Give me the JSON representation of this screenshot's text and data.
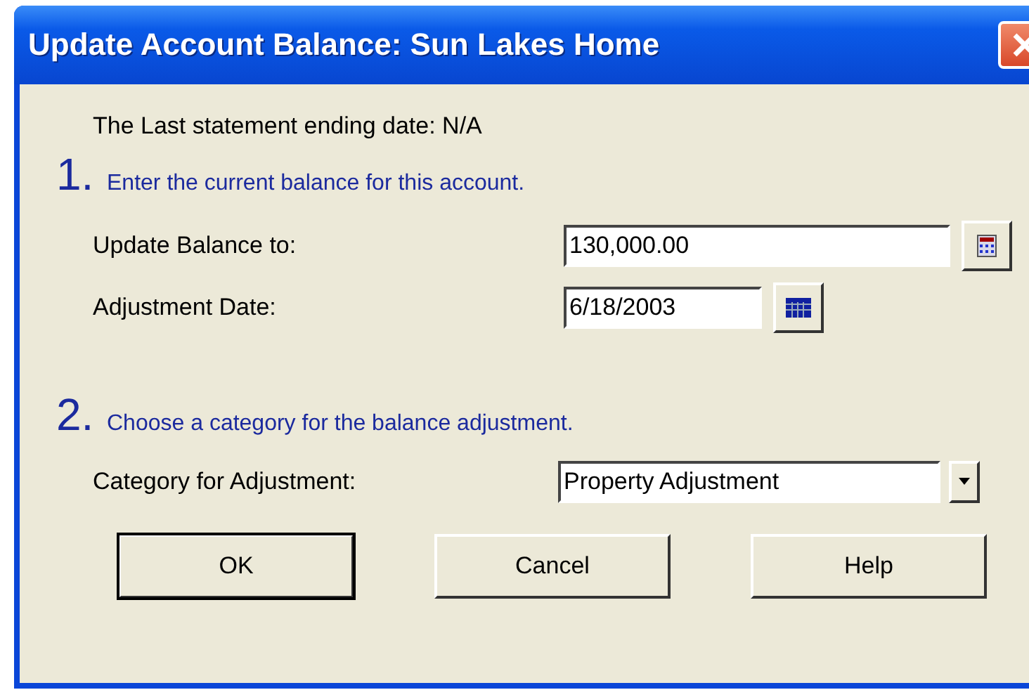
{
  "window": {
    "title": "Update Account Balance: Sun Lakes Home"
  },
  "statement_info": "The Last statement ending date:  N/A",
  "steps": [
    {
      "number": "1.",
      "text": "Enter the current balance for this account."
    },
    {
      "number": "2.",
      "text": "Choose a category for the balance adjustment."
    }
  ],
  "balance": {
    "label": "Update Balance to:",
    "value": "130,000.00"
  },
  "date": {
    "label": "Adjustment Date:",
    "value": "6/18/2003"
  },
  "category": {
    "label": "Category for Adjustment:",
    "value": "Property Adjustment"
  },
  "buttons": [
    {
      "label": "OK",
      "default": true
    },
    {
      "label": "Cancel",
      "default": false
    },
    {
      "label": "Help",
      "default": false
    }
  ]
}
